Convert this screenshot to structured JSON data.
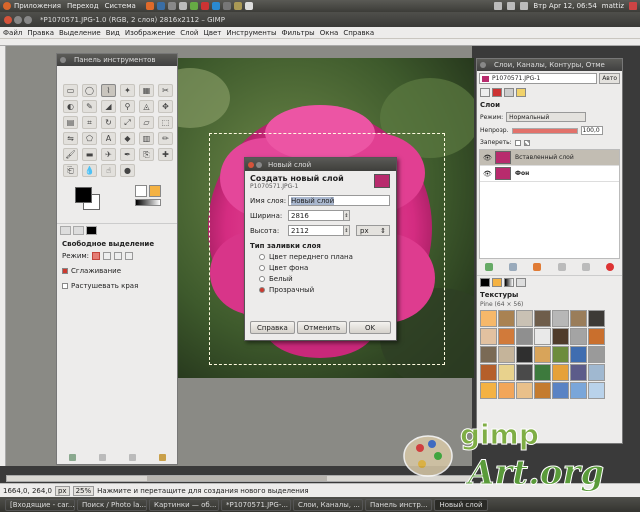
{
  "top_panel": {
    "menus": [
      "Приложения",
      "Переход",
      "Система"
    ],
    "clock": "Втр Apr 12, 06:54",
    "user": "mattiz"
  },
  "window": {
    "title": "*P1070571.JPG-1.0 (RGB, 2 слоя) 2816x2112 – GIMP"
  },
  "menu_bar": [
    "Файл",
    "Правка",
    "Выделение",
    "Вид",
    "Изображение",
    "Слой",
    "Цвет",
    "Инструменты",
    "Фильтры",
    "Окна",
    "Справка"
  ],
  "toolbox": {
    "title": "Панель инструментов",
    "options_title": "Свободное выделение",
    "mode_label": "Режим:",
    "antialias_label": "Сглаживание",
    "feather_label": "Растушевать края",
    "colors": {
      "foreground": "#000000",
      "background": "#ffffff",
      "pattern": "#f4b243"
    }
  },
  "dialog": {
    "title": "Новый слой",
    "heading": "Создать новый слой",
    "subheading": "P1070571.JPG-1",
    "name_label": "Имя слоя:",
    "name_value": "Новый слой",
    "width_label": "Ширина:",
    "width_value": "2816",
    "height_label": "Высота:",
    "height_value": "2112",
    "unit": "px",
    "fill_heading": "Тип заливки слоя",
    "fill_options": [
      "Цвет переднего плана",
      "Цвет фона",
      "Белый",
      "Прозрачный"
    ],
    "selected_fill": "Прозрачный",
    "btn_help": "Справка",
    "btn_cancel": "Отменить",
    "btn_ok": "OK"
  },
  "layers_dock": {
    "title": "Слои, Каналы, Контуры, Отме",
    "image_selector": "P1070571.JPG-1",
    "auto_label": "Авто",
    "section_layers": "Слои",
    "mode_label": "Режим:",
    "mode_value": "Нормальный",
    "opacity_label": "Непрозр.",
    "opacity_value": "100,0",
    "opacity_fraction": 1.0,
    "lock_label": "Запереть:",
    "layers": [
      {
        "name": "Вставленный слой",
        "active": true
      },
      {
        "name": "Фон",
        "active": false
      }
    ],
    "section_patterns": "Текстуры",
    "pattern_info": "Pine (64 × 56)"
  },
  "status_bar": {
    "coords": "1664,0, 264,0",
    "unit": "px",
    "zoom": "25%",
    "message": "Нажмите и перетащите для создания нового выделения"
  },
  "taskbar": [
    "[Входящие - car...",
    "Поиск / Photo la...",
    "Картинки — об...",
    "*P1070571.JPG-...",
    "Слои, Каналы, ...",
    "Панель инстр...",
    "Новый слой"
  ],
  "watermark": {
    "top": "gimp",
    "bottom": "Art.org"
  }
}
